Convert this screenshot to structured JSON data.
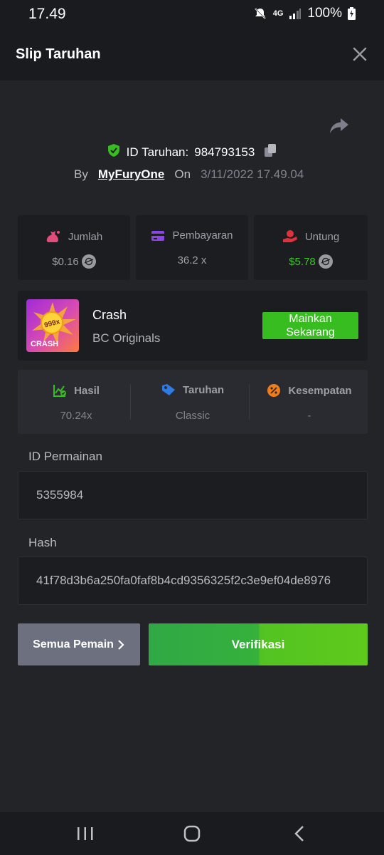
{
  "status_bar": {
    "time": "17.49",
    "network": "4G",
    "battery": "100%"
  },
  "header": {
    "title": "Slip Taruhan"
  },
  "bet": {
    "id_label": "ID Taruhan:",
    "id_value": "984793153",
    "by_label": "By",
    "user": "MyFuryOne",
    "on_label": "On",
    "date": "3/11/2022 17.49.04"
  },
  "stats": [
    {
      "label": "Jumlah",
      "value": "$0.16",
      "icon": "money-bag-icon",
      "icon_color": "#e14d7a"
    },
    {
      "label": "Pembayaran",
      "value": "36.2 x",
      "icon": "card-icon",
      "icon_color": "#8b45e6"
    },
    {
      "label": "Untung",
      "value": "$5.78",
      "icon": "profit-hand-icon",
      "icon_color": "#e0323e",
      "value_color": "#3fc22a"
    }
  ],
  "game": {
    "name": "Crash",
    "provider": "BC Originals",
    "thumb_text": "CRASH",
    "thumb_badge": "999x",
    "play_label": "Mainkan Sekarang"
  },
  "info": [
    {
      "label": "Hasil",
      "value": "70.24x",
      "icon": "chart-check-icon",
      "icon_color": "#37bd1f"
    },
    {
      "label": "Taruhan",
      "value": "Classic",
      "icon": "tag-icon",
      "icon_color": "#2f7be6"
    },
    {
      "label": "Kesempatan",
      "value": "-",
      "icon": "percent-icon",
      "icon_color": "#f07d1a"
    }
  ],
  "fields": {
    "game_id_label": "ID Permainan",
    "game_id_value": "5355984",
    "hash_label": "Hash",
    "hash_value": "41f78d3b6a250fa0faf8b4cd9356325f2c3e9ef04de8976"
  },
  "actions": {
    "all_players": "Semua Pemain",
    "verify": "Verifikasi"
  }
}
